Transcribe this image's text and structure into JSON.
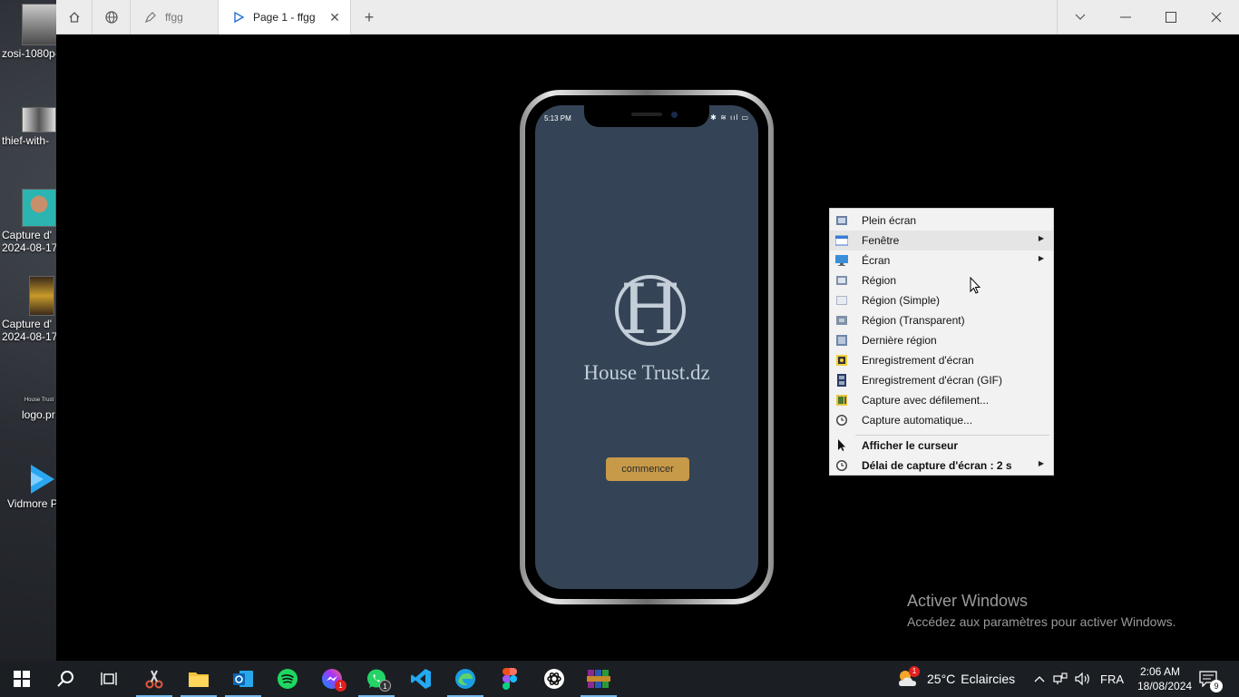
{
  "desktop": {
    "icons": [
      {
        "label": "zosi-1080p-",
        "name": "desktop-icon-zosi"
      },
      {
        "label": "thief-with-",
        "name": "desktop-icon-thief"
      },
      {
        "label_line1": "Capture d'",
        "label_line2": "2024-08-17",
        "name": "desktop-icon-capture-1"
      },
      {
        "label_line1": "Capture d'",
        "label_line2": "2024-08-17",
        "name": "desktop-icon-capture-2"
      },
      {
        "label": "logo.pr",
        "thumb_text": "House Trust",
        "name": "desktop-icon-logo"
      },
      {
        "label": "Vidmore P",
        "name": "desktop-icon-vidmore"
      }
    ]
  },
  "browser": {
    "tabs": [
      {
        "label": "ffgg"
      },
      {
        "label": "Page 1 - ffgg"
      }
    ],
    "new_tab": "+"
  },
  "phone": {
    "status_time": "5:13 PM",
    "status_icons": "✱ ≋ ııl ▭",
    "logo_letter": "H",
    "brand_name": "House Trust.dz",
    "start_button": "commencer"
  },
  "context_menu": {
    "items": [
      {
        "label": "Plein écran",
        "icon": "fullscreen-capture-icon",
        "submenu": false,
        "bold": false
      },
      {
        "label": "Fenêtre",
        "icon": "window-capture-icon",
        "submenu": true,
        "bold": false
      },
      {
        "label": "Écran",
        "icon": "monitor-capture-icon",
        "submenu": true,
        "bold": false
      },
      {
        "label": "Région",
        "icon": "region-capture-icon",
        "submenu": false,
        "bold": false
      },
      {
        "label": "Région (Simple)",
        "icon": "region-simple-icon",
        "submenu": false,
        "bold": false
      },
      {
        "label": "Région (Transparent)",
        "icon": "region-transparent-icon",
        "submenu": false,
        "bold": false
      },
      {
        "label": "Dernière région",
        "icon": "last-region-icon",
        "submenu": false,
        "bold": false
      },
      {
        "label": "Enregistrement d'écran",
        "icon": "screen-record-icon",
        "submenu": false,
        "bold": false
      },
      {
        "label": "Enregistrement d'écran (GIF)",
        "icon": "screen-record-gif-icon",
        "submenu": false,
        "bold": false
      },
      {
        "label": "Capture avec défilement...",
        "icon": "scrolling-capture-icon",
        "submenu": false,
        "bold": false
      },
      {
        "label": "Capture automatique...",
        "icon": "auto-capture-icon",
        "submenu": false,
        "bold": false
      },
      {
        "label": "Afficher le curseur",
        "icon": "cursor-icon",
        "submenu": false,
        "bold": true
      },
      {
        "label": "Délai de capture d'écran : 2 s",
        "icon": "delay-clock-icon",
        "submenu": true,
        "bold": true
      }
    ]
  },
  "watermark": {
    "title": "Activer Windows",
    "subtitle": "Accédez aux paramètres pour activer Windows."
  },
  "taskbar": {
    "apps": [
      {
        "name": "start-button",
        "icon": "windows-logo-icon"
      },
      {
        "name": "search-button",
        "icon": "search-icon"
      },
      {
        "name": "task-view-button",
        "icon": "task-view-icon"
      },
      {
        "name": "taskbar-app-snipping",
        "icon": "scissors-icon"
      },
      {
        "name": "taskbar-app-explorer",
        "icon": "folder-icon"
      },
      {
        "name": "taskbar-app-outlook",
        "icon": "outlook-icon"
      },
      {
        "name": "taskbar-app-spotify",
        "icon": "spotify-icon"
      },
      {
        "name": "taskbar-app-messenger",
        "icon": "messenger-icon",
        "badge": "1"
      },
      {
        "name": "taskbar-app-whatsapp",
        "icon": "whatsapp-icon",
        "badge": "1"
      },
      {
        "name": "taskbar-app-vscode",
        "icon": "vscode-icon"
      },
      {
        "name": "taskbar-app-edge",
        "icon": "edge-icon"
      },
      {
        "name": "taskbar-app-figma",
        "icon": "figma-icon"
      },
      {
        "name": "taskbar-app-chatgpt",
        "icon": "chatgpt-icon"
      },
      {
        "name": "taskbar-app-winrar",
        "icon": "winrar-icon"
      }
    ],
    "weather": {
      "badge": "1",
      "temp": "25°C",
      "condition": "Eclaircies"
    },
    "language": "FRA",
    "time": "2:06 AM",
    "date": "18/08/2024",
    "notifications": "9"
  }
}
